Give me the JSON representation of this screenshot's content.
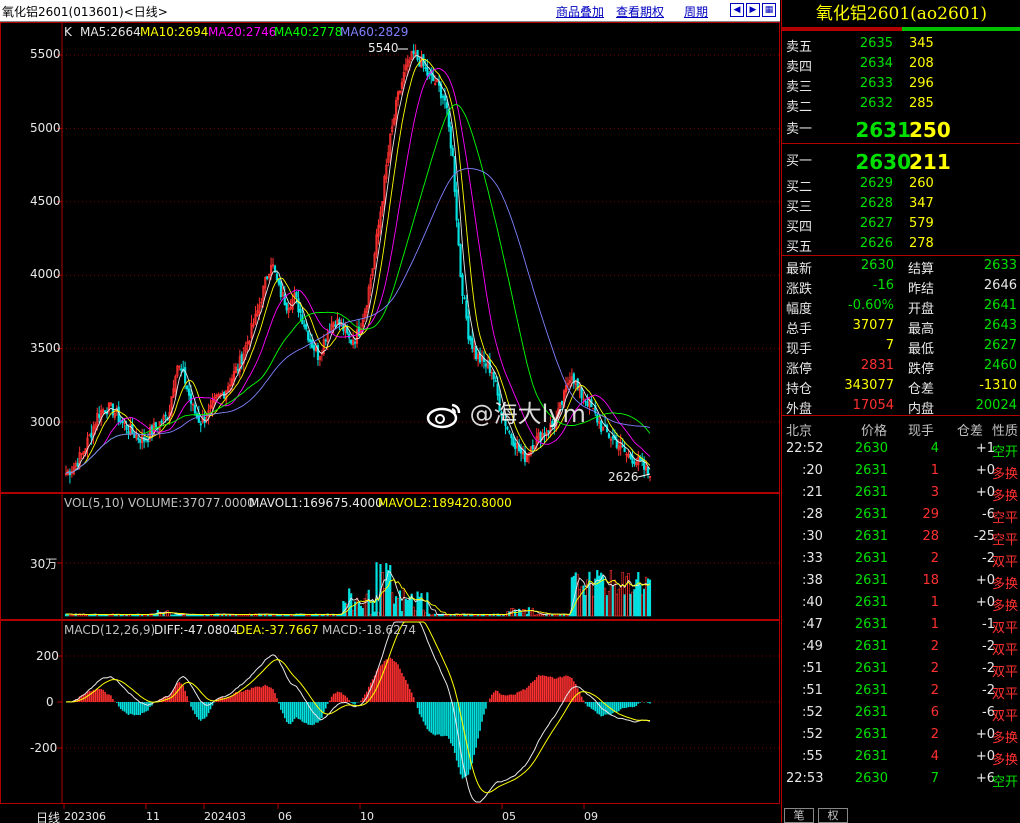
{
  "topbar": {
    "title": "氧化铝2601(013601)<日线>",
    "menu": [
      "商品叠加",
      "查看期权",
      "周期"
    ],
    "nav_icons": [
      "arrow-left-icon",
      "arrow-right-icon",
      "grid-icon"
    ]
  },
  "kline_header": {
    "k": "K",
    "ma5": "MA5:2664",
    "ma10": "MA10:2694",
    "ma20": "MA20:2746",
    "ma40": "MA40:2778",
    "ma60": "MA60:2829"
  },
  "price_axis": [
    "5500",
    "5000",
    "4500",
    "4000",
    "3500",
    "3000"
  ],
  "annotations": {
    "high": "5540",
    "low": "2626"
  },
  "volume_header": {
    "vol": "VOL(5,10)",
    "volume": "VOLUME:37077.0000",
    "mavol1": "MAVOL1:169675.4000",
    "mavol2": "MAVOL2:189420.8000"
  },
  "volume_axis": [
    "30万"
  ],
  "macd_header": {
    "macd": "MACD(12,26,9)",
    "diff": "DIFF:-47.0804",
    "dea": "DEA:-37.7667",
    "value": "MACD:-18.6274"
  },
  "macd_axis": [
    "200",
    "0",
    "-200"
  ],
  "time_axis": {
    "period": "日线",
    "ticks": [
      "202306",
      "11",
      "202403",
      "06",
      "10",
      "05",
      "09"
    ]
  },
  "watermark": "@海大lym",
  "right_panel": {
    "title": "氧化铝2601(ao2601)",
    "asks": [
      {
        "label": "卖五",
        "price": "2635",
        "vol": "345"
      },
      {
        "label": "卖四",
        "price": "2634",
        "vol": "208"
      },
      {
        "label": "卖三",
        "price": "2633",
        "vol": "296"
      },
      {
        "label": "卖二",
        "price": "2632",
        "vol": "285"
      },
      {
        "label": "卖一",
        "price": "2631",
        "vol": "250"
      }
    ],
    "bids": [
      {
        "label": "买一",
        "price": "2630",
        "vol": "211"
      },
      {
        "label": "买二",
        "price": "2629",
        "vol": "260"
      },
      {
        "label": "买三",
        "price": "2628",
        "vol": "347"
      },
      {
        "label": "买四",
        "price": "2627",
        "vol": "579"
      },
      {
        "label": "买五",
        "price": "2626",
        "vol": "278"
      }
    ],
    "stats": [
      {
        "l1": "最新",
        "v1": "2630",
        "c1": "green",
        "l2": "结算",
        "v2": "2633",
        "c2": "green"
      },
      {
        "l1": "涨跌",
        "v1": "-16",
        "c1": "green",
        "l2": "昨结",
        "v2": "2646",
        "c2": "white"
      },
      {
        "l1": "幅度",
        "v1": "-0.60%",
        "c1": "green",
        "l2": "开盘",
        "v2": "2641",
        "c2": "green"
      },
      {
        "l1": "总手",
        "v1": "37077",
        "c1": "yellow",
        "l2": "最高",
        "v2": "2643",
        "c2": "green"
      },
      {
        "l1": "现手",
        "v1": "7",
        "c1": "yellow",
        "l2": "最低",
        "v2": "2627",
        "c2": "green"
      },
      {
        "l1": "涨停",
        "v1": "2831",
        "c1": "red",
        "l2": "跌停",
        "v2": "2460",
        "c2": "green"
      },
      {
        "l1": "持仓",
        "v1": "343077",
        "c1": "yellow",
        "l2": "仓差",
        "v2": "-1310",
        "c2": "yellow"
      },
      {
        "l1": "外盘",
        "v1": "17054",
        "c1": "red",
        "l2": "内盘",
        "v2": "20024",
        "c2": "green"
      }
    ],
    "ticks_header": [
      "北京",
      "价格",
      "现手",
      "仓差",
      "性质"
    ],
    "ticks": [
      {
        "time": "22:52",
        "price": "2630",
        "vol": "4",
        "vc": "green",
        "oi": "+1",
        "type": "空开",
        "tc": "green"
      },
      {
        "time": ":20",
        "price": "2631",
        "vol": "1",
        "vc": "red",
        "oi": "+0",
        "type": "多换",
        "tc": "red"
      },
      {
        "time": ":21",
        "price": "2631",
        "vol": "3",
        "vc": "red",
        "oi": "+0",
        "type": "多换",
        "tc": "red"
      },
      {
        "time": ":28",
        "price": "2631",
        "vol": "29",
        "vc": "red",
        "oi": "-6",
        "type": "空平",
        "tc": "red"
      },
      {
        "time": ":30",
        "price": "2631",
        "vol": "28",
        "vc": "red",
        "oi": "-25",
        "type": "空平",
        "tc": "red"
      },
      {
        "time": ":33",
        "price": "2631",
        "vol": "2",
        "vc": "red",
        "oi": "-2",
        "type": "双平",
        "tc": "red"
      },
      {
        "time": ":38",
        "price": "2631",
        "vol": "18",
        "vc": "red",
        "oi": "+0",
        "type": "多换",
        "tc": "red"
      },
      {
        "time": ":40",
        "price": "2631",
        "vol": "1",
        "vc": "red",
        "oi": "+0",
        "type": "多换",
        "tc": "red"
      },
      {
        "time": ":47",
        "price": "2631",
        "vol": "1",
        "vc": "red",
        "oi": "-1",
        "type": "双平",
        "tc": "red"
      },
      {
        "time": ":49",
        "price": "2631",
        "vol": "2",
        "vc": "red",
        "oi": "-2",
        "type": "双平",
        "tc": "red"
      },
      {
        "time": ":51",
        "price": "2631",
        "vol": "2",
        "vc": "red",
        "oi": "-2",
        "type": "双平",
        "tc": "red"
      },
      {
        "time": ":51",
        "price": "2631",
        "vol": "2",
        "vc": "red",
        "oi": "-2",
        "type": "双平",
        "tc": "red"
      },
      {
        "time": ":52",
        "price": "2631",
        "vol": "6",
        "vc": "red",
        "oi": "-6",
        "type": "双平",
        "tc": "red"
      },
      {
        "time": ":52",
        "price": "2631",
        "vol": "2",
        "vc": "red",
        "oi": "+0",
        "type": "多换",
        "tc": "red"
      },
      {
        "time": ":55",
        "price": "2631",
        "vol": "4",
        "vc": "red",
        "oi": "+0",
        "type": "多换",
        "tc": "red"
      },
      {
        "time": "22:53",
        "price": "2630",
        "vol": "7",
        "vc": "green",
        "oi": "+6",
        "type": "空开",
        "tc": "green"
      }
    ],
    "bottom_tabs": [
      "笔",
      "权"
    ]
  },
  "colors": {
    "up": "#ff3030",
    "down": "#00e0e0",
    "ma5": "#e8e8e8",
    "ma10": "#ffff00",
    "ma20": "#ff00ff",
    "ma40": "#00ff00",
    "ma60": "#8080ff",
    "grid": "#800000"
  },
  "chart_data": {
    "type": "candlestick",
    "title": "氧化铝2601(013601)<日线>",
    "y_ticks": [
      3000,
      3500,
      4000,
      4500,
      5000,
      5500
    ],
    "x_ticks": [
      "202306",
      "11",
      "202403",
      "06",
      "10",
      "05",
      "09"
    ],
    "high_marker": 5540,
    "low_marker": 2626,
    "close_path": [
      2650,
      2700,
      2780,
      2900,
      3050,
      3100,
      3080,
      3000,
      2950,
      2900,
      2880,
      2950,
      3000,
      3050,
      3400,
      3300,
      3100,
      3000,
      3050,
      3150,
      3200,
      3300,
      3400,
      3550,
      3700,
      3900,
      4100,
      3900,
      3800,
      3850,
      3700,
      3550,
      3450,
      3600,
      3700,
      3650,
      3550,
      3600,
      3800,
      4100,
      4500,
      4900,
      5200,
      5400,
      5500,
      5450,
      5350,
      5300,
      5200,
      4800,
      4000,
      3600,
      3450,
      3400,
      3350,
      3100,
      2950,
      2850,
      2750,
      2850,
      2900,
      2950,
      3000,
      3150,
      3350,
      3200,
      3150,
      3050,
      2950,
      2900,
      2850,
      2780,
      2750,
      2700,
      2630
    ],
    "macd_diff_range": [
      -300,
      280
    ]
  }
}
